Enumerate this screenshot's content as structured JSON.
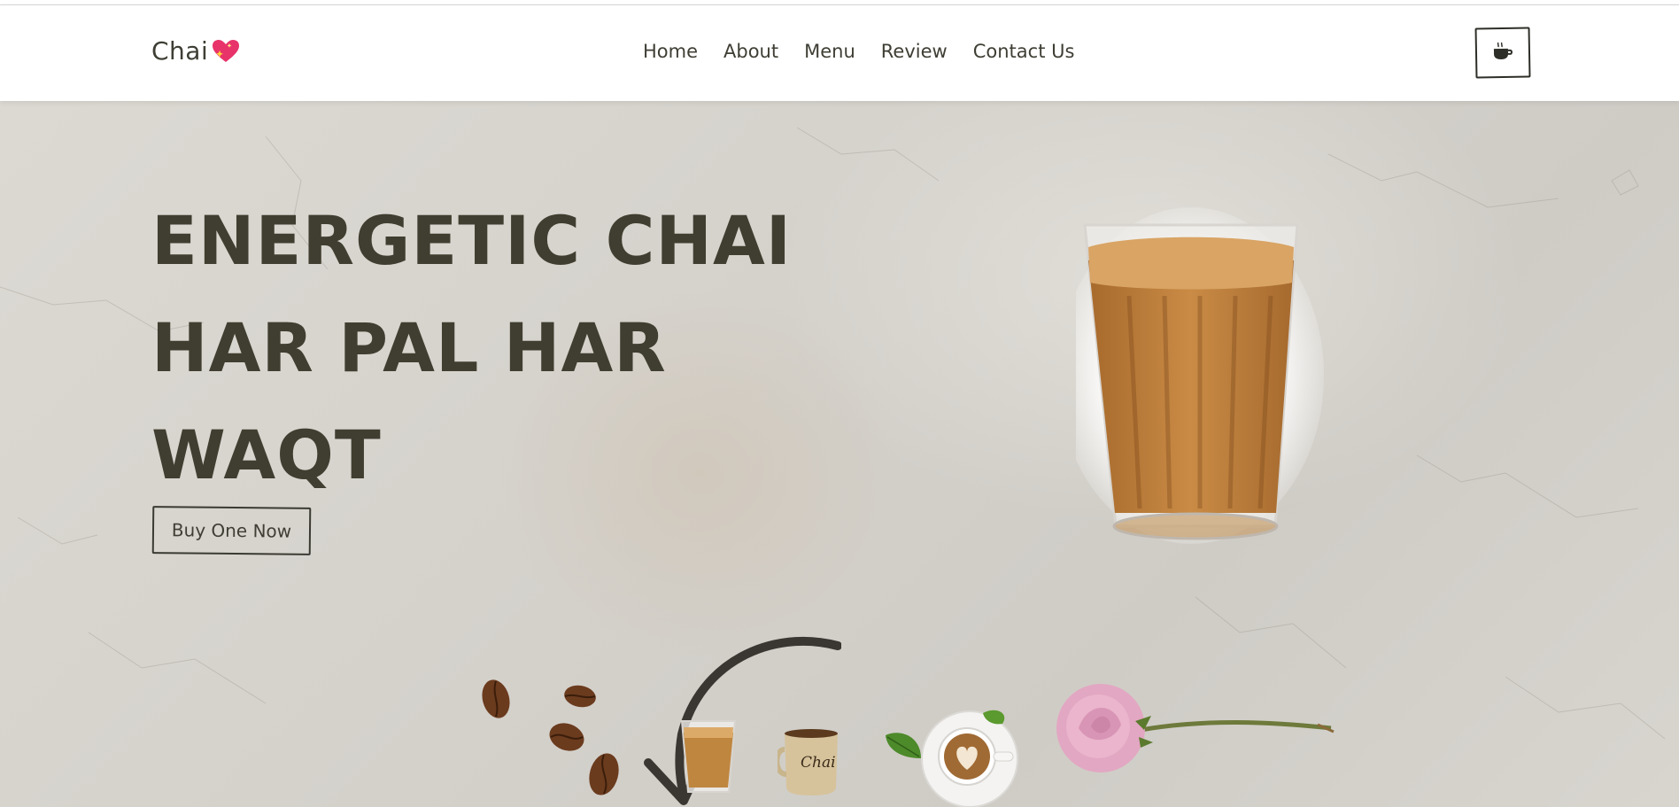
{
  "header": {
    "brand": "Chai",
    "brand_icon": "sparkling-heart-icon",
    "nav": [
      "Home",
      "About",
      "Menu",
      "Review",
      "Contact Us"
    ],
    "cart_icon": "coffee-cup-icon"
  },
  "hero": {
    "headline_lines": [
      "ENERGETIC CHAI",
      "HAR PAL HAR",
      "WAQT"
    ],
    "cta_label": "Buy One Now"
  },
  "colors": {
    "text_dark": "#3f3e30",
    "background": "#d8d5cf",
    "accent_heart": "#e8336a"
  }
}
